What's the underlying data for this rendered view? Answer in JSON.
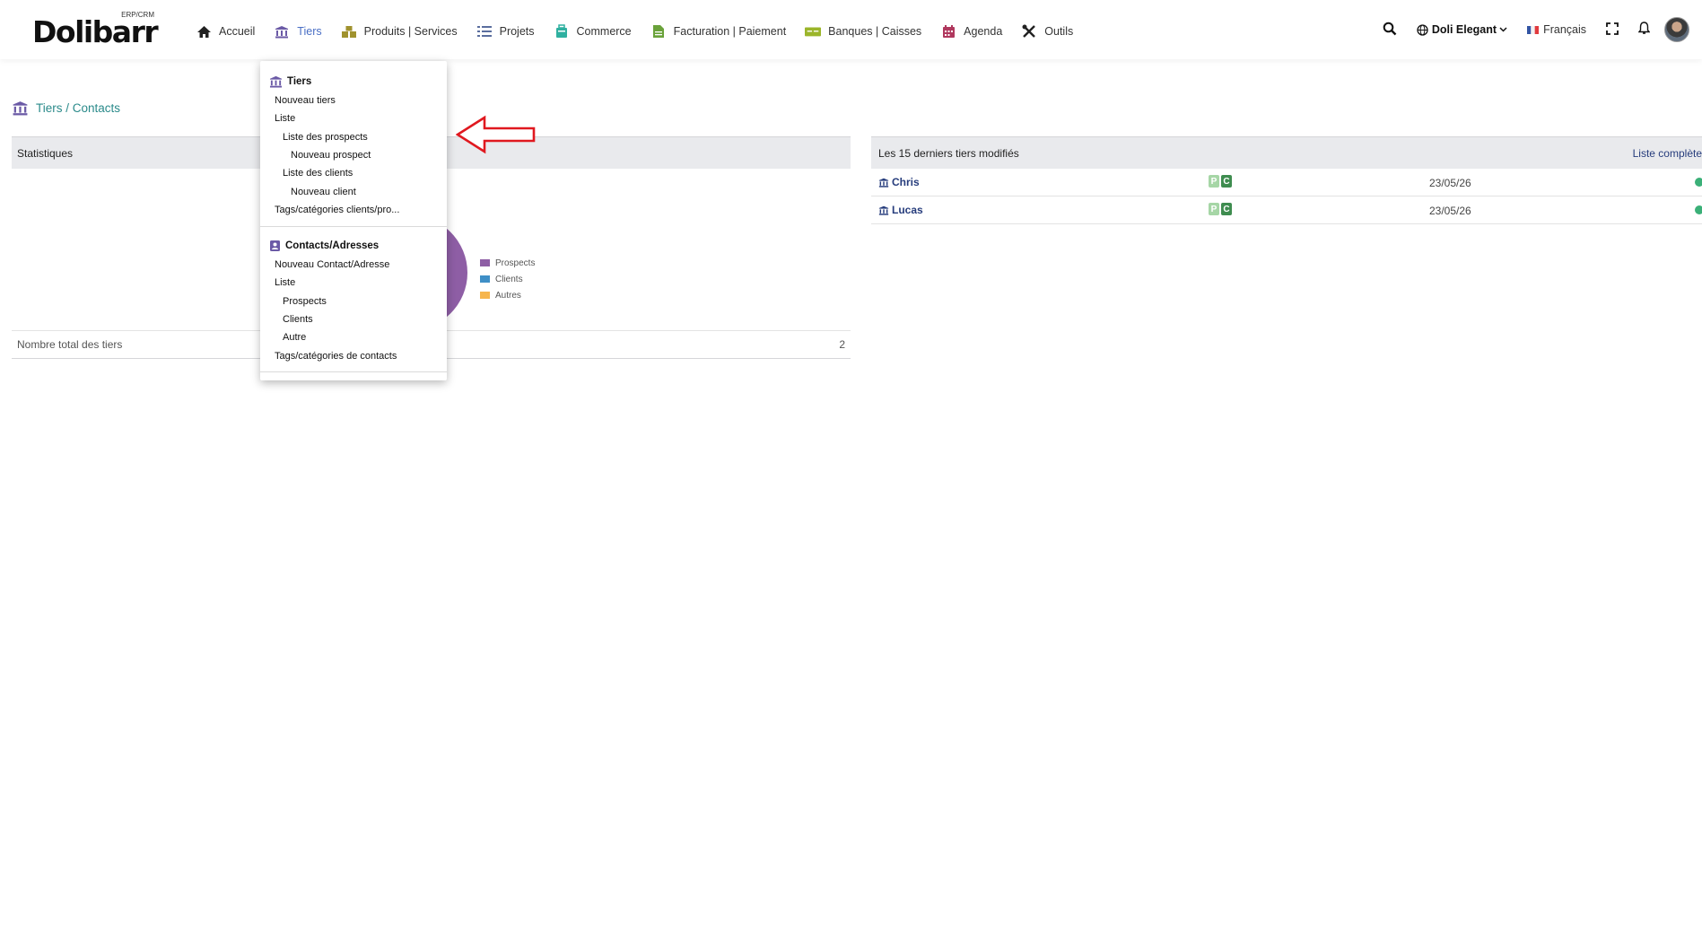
{
  "logo": {
    "word": "Dolibarr",
    "tag": "ERP/CRM"
  },
  "menu": [
    {
      "label": "Accueil",
      "icon": "home-icon"
    },
    {
      "label": "Tiers",
      "icon": "building-icon",
      "active": true
    },
    {
      "label": "Produits | Services",
      "icon": "cube-icon"
    },
    {
      "label": "Projets",
      "icon": "tasks-icon"
    },
    {
      "label": "Commerce",
      "icon": "suitcase-icon"
    },
    {
      "label": "Facturation | Paiement",
      "icon": "invoice-icon"
    },
    {
      "label": "Banques | Caisses",
      "icon": "bank-icon"
    },
    {
      "label": "Agenda",
      "icon": "calendar-icon"
    },
    {
      "label": "Outils",
      "icon": "tools-icon"
    }
  ],
  "rightbar": {
    "entity": "Doli Elegant",
    "language": "Français"
  },
  "page": {
    "title": "Tiers / Contacts"
  },
  "stats": {
    "header": "Statistiques",
    "total_label": "Nombre total des tiers",
    "total_value": "2",
    "legend": [
      {
        "label": "Prospects",
        "color": "#8e5ea5"
      },
      {
        "label": "Clients",
        "color": "#3f8fc7"
      },
      {
        "label": "Autres",
        "color": "#f6b54d"
      }
    ]
  },
  "last_modified": {
    "header": "Les 15 derniers tiers modifiés",
    "full_list_link": "Liste complète",
    "rows": [
      {
        "name": "Chris",
        "badge_p": "P",
        "badge_c": "C",
        "date": "23/05/26"
      },
      {
        "name": "Lucas",
        "badge_p": "P",
        "badge_c": "C",
        "date": "23/05/26"
      }
    ]
  },
  "dropdown": {
    "tiers_header": "Tiers",
    "tiers_items": [
      {
        "label": "Nouveau tiers",
        "level": 1
      },
      {
        "label": "Liste",
        "level": 1
      },
      {
        "label": "Liste des prospects",
        "level": 2
      },
      {
        "label": "Nouveau prospect",
        "level": 3
      },
      {
        "label": "Liste des clients",
        "level": 2
      },
      {
        "label": "Nouveau client",
        "level": 3
      },
      {
        "label": "Tags/catégories clients/pro...",
        "level": 1
      }
    ],
    "contacts_header": "Contacts/Adresses",
    "contacts_items": [
      {
        "label": "Nouveau Contact/Adresse",
        "level": 1
      },
      {
        "label": "Liste",
        "level": 1
      },
      {
        "label": "Prospects",
        "level": 2
      },
      {
        "label": "Clients",
        "level": 2
      },
      {
        "label": "Autre",
        "level": 2
      },
      {
        "label": "Tags/catégories de contacts",
        "level": 1
      }
    ]
  },
  "colors": {
    "accent": "#4a6fc5",
    "title_teal": "#2a8a8a",
    "link_navy": "#263c7c",
    "arrow_red": "#e0181f"
  }
}
